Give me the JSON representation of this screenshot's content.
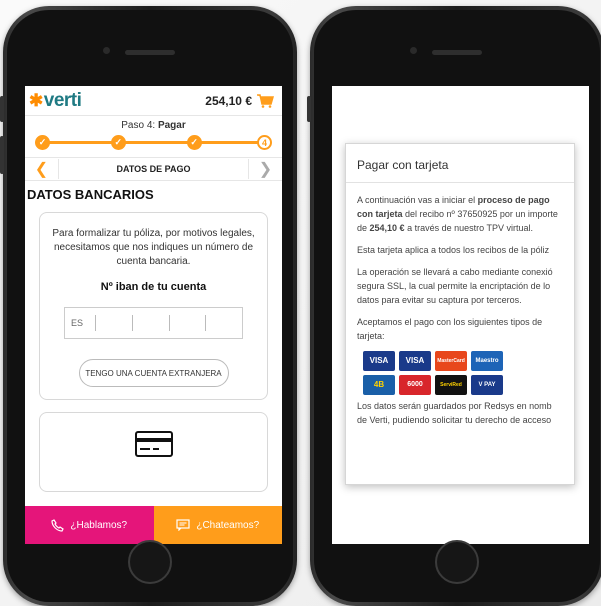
{
  "left": {
    "header": {
      "price": "254,10 €"
    },
    "step": {
      "prefix": "Paso 4:",
      "current": "Pagar",
      "last_step_number": "4"
    },
    "subnav": {
      "title": "DATOS DE PAGO"
    },
    "section_title": "DATOS BANCARIOS",
    "iban_card": {
      "description": "Para formalizar tu póliza, por motivos legales, necesitamos que nos indiques un número de cuenta bancaria.",
      "iban_label": "Nº iban de tu cuenta",
      "iban_prefix": "ES",
      "foreign_button": "TENGO UNA CUENTA EXTRANJERA"
    },
    "bottom_bar": {
      "call_label": "¿Hablamos?",
      "chat_label": "¿Chateamos?"
    }
  },
  "right": {
    "modal": {
      "title": "Pagar con tarjeta",
      "p1_a": "A continuación vas a iniciar el ",
      "p1_b": "proceso de pago con tarjeta",
      "p1_c": " del recibo nº 37650925 por un importe de ",
      "p1_d": "254,10 €",
      "p1_e": " a través de nuestro TPV virtual.",
      "p2": "Esta tarjeta aplica a todos los recibos de la póliz",
      "p3_l1": "La operación se llevará a cabo mediante conexió",
      "p3_l2": "segura SSL, la cual permite la encriptación de lo",
      "p3_l3": "datos para evitar su captura por terceros.",
      "p4": "Aceptamos el pago con los siguientes tipos de tarjeta:",
      "card_logos": [
        "VISA",
        "VISA",
        "MasterCard",
        "Maestro",
        "4B",
        "6000",
        "ServiRed",
        "V PAY"
      ],
      "p5_l1": "Los datos serán guardados por Redsys en nomb",
      "p5_l2": "de Verti, pudiendo solicitar tu derecho de acceso"
    }
  },
  "colors": {
    "brand_teal": "#1f7a83",
    "orange": "#ff9d1b",
    "pink": "#e5157a"
  }
}
